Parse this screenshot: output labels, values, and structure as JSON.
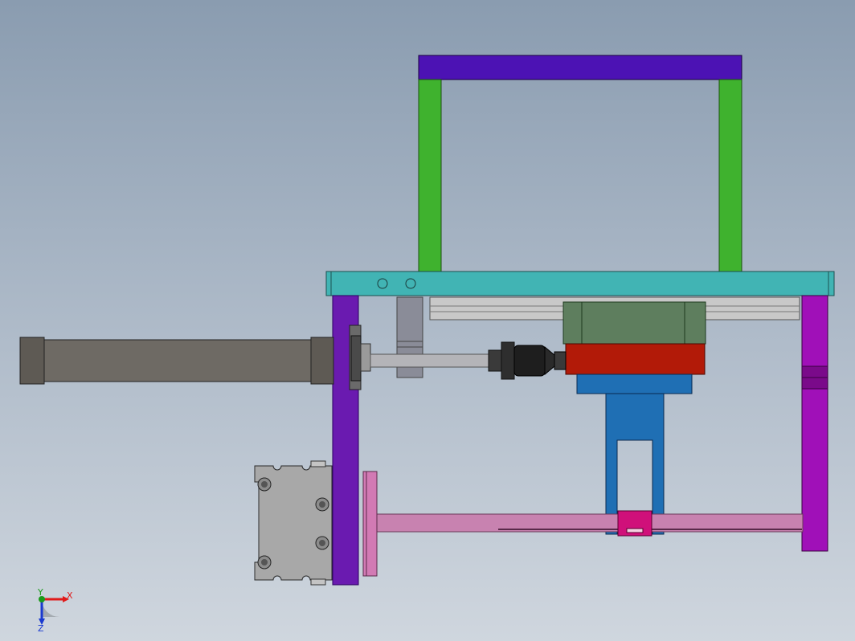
{
  "viewport": {
    "background_top": "#8a9cb0",
    "background_bottom": "#cfd6de"
  },
  "triad": {
    "x_label": "X",
    "y_label": "Y",
    "z_label": "Z",
    "x_color": "#e01a1a",
    "y_color": "#1a9a1a",
    "z_color": "#1a3ad0"
  },
  "parts": {
    "top_beam_color": "#4c12b4",
    "upright_color": "#3fb22e",
    "plate_color": "#41b4b4",
    "left_side_color": "#6a1ab0",
    "right_side_color": "#a010b8",
    "cylinder_color": "#6e6a64",
    "rod_color": "#b4b4b8",
    "rail_color": "#c8c8c8",
    "slider_color": "#5e7e5e",
    "red_block_color": "#b21a08",
    "blue_bracket_color": "#1f6fb4",
    "pink_rod_color": "#c882b0",
    "magenta_clip_color": "#d0107a",
    "motor_color": "#a8a8a8",
    "flange_color": "#d27ab4"
  }
}
